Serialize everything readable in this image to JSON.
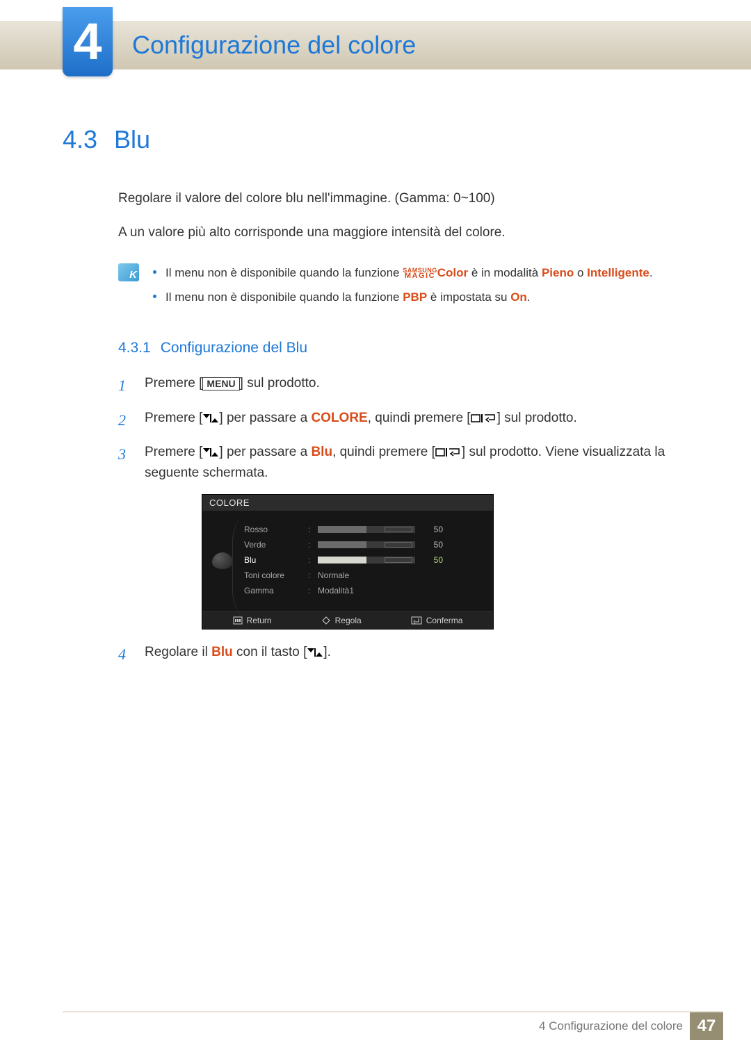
{
  "header": {
    "chapter_number": "4",
    "chapter_title": "Configurazione del colore"
  },
  "section": {
    "number": "4.3",
    "title": "Blu",
    "intro1": "Regolare il valore del colore blu nell'immagine. (Gamma: 0~100)",
    "intro2": "A un valore più alto corrisponde una maggiore intensità del colore."
  },
  "note": {
    "samsung_top": "SAMSUNG",
    "samsung_bot": "MAGIC",
    "item1_a": "Il menu non è disponibile quando la funzione ",
    "item1_color": "Color",
    "item1_b": " è in modalità ",
    "item1_mode1": "Pieno",
    "item1_or": " o ",
    "item1_mode2": "Intelligente",
    "item1_end": ".",
    "item2_a": "Il menu non è disponibile quando la funzione ",
    "item2_pbp": "PBP",
    "item2_b": " è impostata su ",
    "item2_on": "On",
    "item2_end": "."
  },
  "subsection": {
    "number": "4.3.1",
    "title": "Configurazione del Blu"
  },
  "steps": {
    "s1_a": "Premere [",
    "s1_menu": "MENU",
    "s1_b": "] sul prodotto.",
    "s2_a": "Premere [",
    "s2_b": "] per passare a ",
    "s2_colore": "COLORE",
    "s2_c": ", quindi premere [",
    "s2_d": "] sul prodotto.",
    "s3_a": "Premere [",
    "s3_b": "] per passare a ",
    "s3_blu": "Blu",
    "s3_c": ", quindi premere [",
    "s3_d": "] sul prodotto. Viene visualizzata la seguente schermata.",
    "s4_a": "Regolare il ",
    "s4_blu": "Blu",
    "s4_b": " con il tasto [",
    "s4_c": "]."
  },
  "osd": {
    "title": "COLORE",
    "rows": [
      {
        "label": "Rosso",
        "value": 50,
        "active": false
      },
      {
        "label": "Verde",
        "value": 50,
        "active": false
      },
      {
        "label": "Blu",
        "value": 50,
        "active": true
      }
    ],
    "text_rows": [
      {
        "label": "Toni colore",
        "value": "Normale"
      },
      {
        "label": "Gamma",
        "value": "Modalità1"
      }
    ],
    "footer": {
      "return": "Return",
      "adjust": "Regola",
      "confirm": "Conferma"
    }
  },
  "footer": {
    "text": "4 Configurazione del colore",
    "page": "47"
  },
  "chart_data": {
    "type": "bar",
    "title": "COLORE OSD sliders",
    "categories": [
      "Rosso",
      "Verde",
      "Blu"
    ],
    "values": [
      50,
      50,
      50
    ],
    "ylim": [
      0,
      100
    ],
    "xlabel": "",
    "ylabel": ""
  }
}
